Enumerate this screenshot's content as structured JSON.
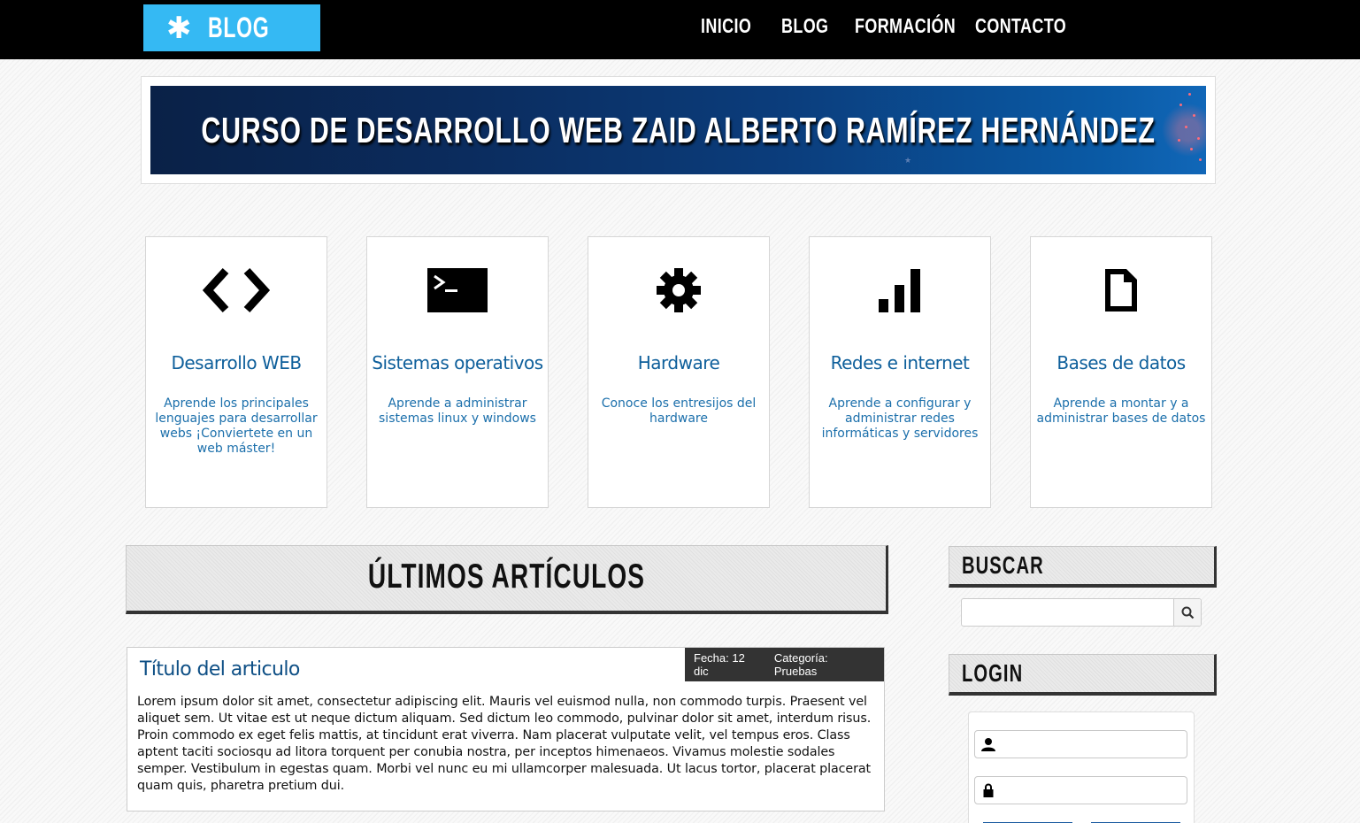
{
  "header": {
    "logo_text": "BLOG",
    "nav": [
      "INICIO",
      "BLOG",
      "FORMACIÓN",
      "CONTACTO"
    ]
  },
  "banner": {
    "title": "CURSO DE DESARROLLO WEB ZAID ALBERTO RAMÍREZ HERNÁNDEZ"
  },
  "categories": [
    {
      "icon": "code-icon",
      "title": "Desarrollo WEB",
      "text": "Aprende los principales lenguajes para desarrollar webs ¡Conviertete en un web máster!"
    },
    {
      "icon": "terminal-icon",
      "title": "Sistemas operativos",
      "text": "Aprende a administrar sistemas linux y windows"
    },
    {
      "icon": "gear-icon",
      "title": "Hardware",
      "text": "Conoce los entresijos del hardware"
    },
    {
      "icon": "signal-bars-icon",
      "title": "Redes e internet",
      "text": "Aprende a configurar y administrar redes informáticas y servidores"
    },
    {
      "icon": "file-icon",
      "title": "Bases de datos",
      "text": "Aprende a montar y a administrar bases de datos"
    }
  ],
  "articles": {
    "heading": "ÚLTIMOS ARTÍCULOS",
    "items": [
      {
        "title": "Título del articulo",
        "date_label": "Fecha: 12 dic",
        "category_label": "Categoría: Pruebas",
        "body": "Lorem ipsum dolor sit amet, consectetur adipiscing elit. Mauris vel euismod nulla, non commodo turpis. Praesent vel aliquet sem. Ut vitae est ut neque dictum aliquam. Sed dictum leo commodo, pulvinar dolor sit amet, interdum risus. Proin commodo ex eget felis mattis, at tincidunt erat viverra. Nam placerat vulputate velit, vel tempus eros. Class aptent taciti sociosqu ad litora torquent per conubia nostra, per inceptos himenaeos. Vivamus molestie sodales semper. Vestibulum in egestas quam. Morbi vel nunc eu mi ullamcorper malesuada. Ut lacus tortor, placerat placerat quam quis, pharetra pretium dui."
      }
    ]
  },
  "sidebar": {
    "search_heading": "BUSCAR",
    "search_value": "",
    "login_heading": "LOGIN",
    "username_value": "",
    "password_value": ""
  },
  "colors": {
    "accent": "#35b9f3",
    "link": "#0e5f9b",
    "topbar": "#000000"
  }
}
